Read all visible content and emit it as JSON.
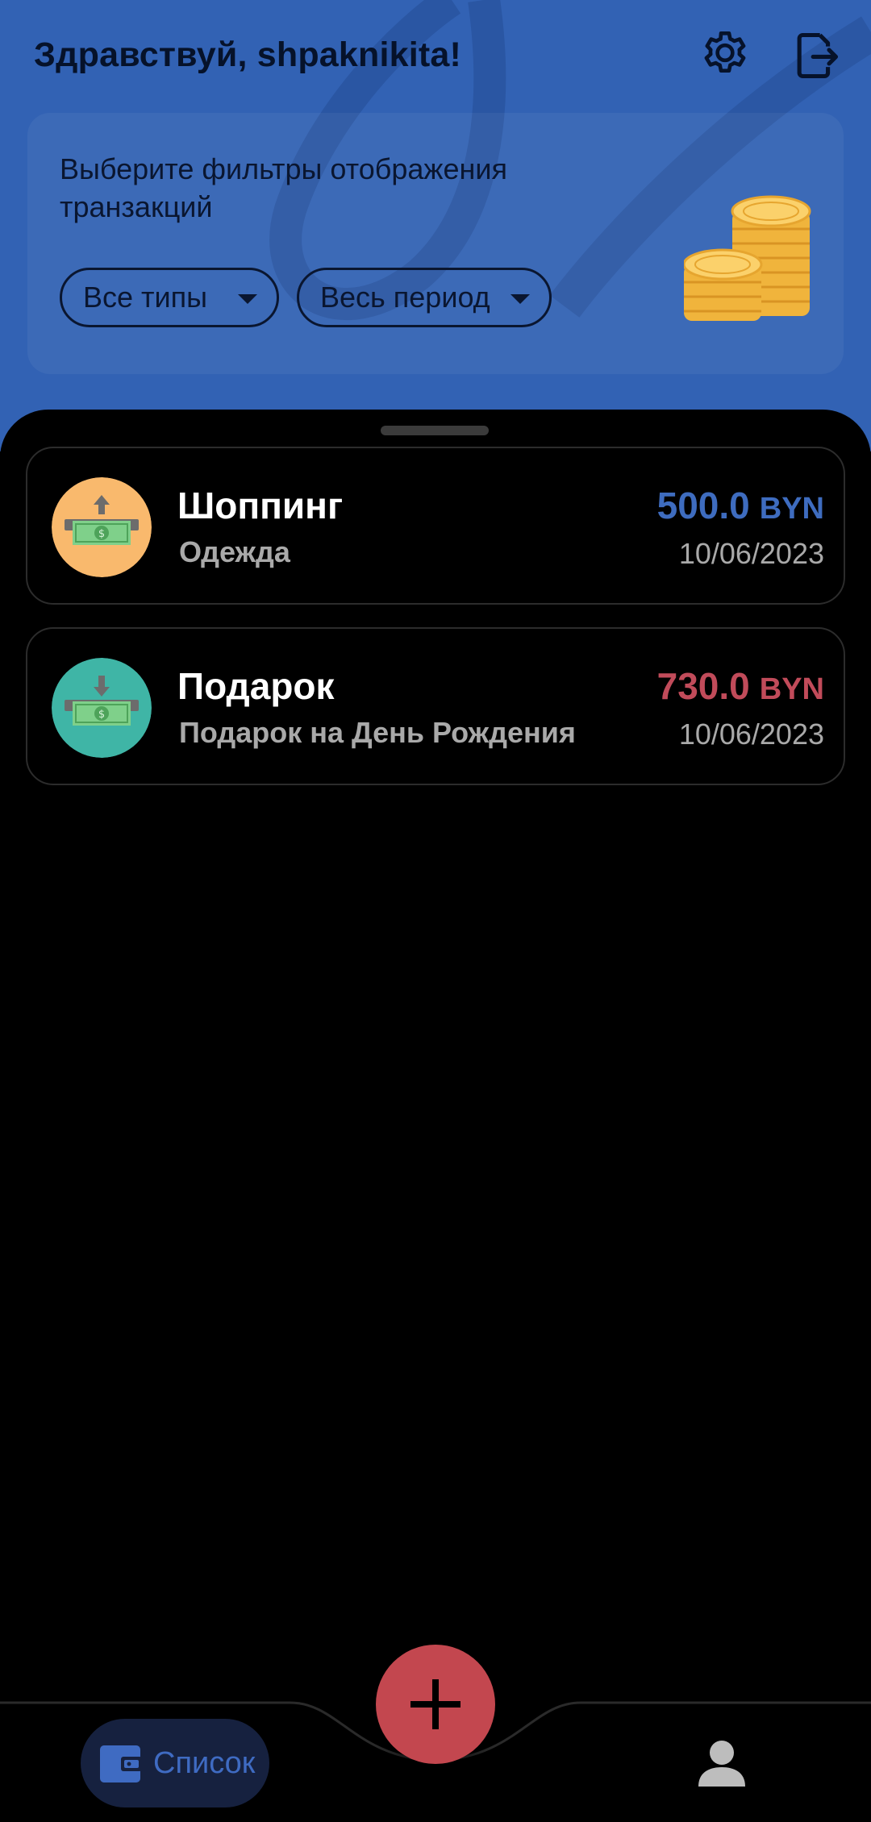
{
  "header": {
    "greeting": "Здравствуй, shpaknikita!",
    "settings_icon": "gear-icon",
    "logout_icon": "logout-icon"
  },
  "filters": {
    "hint": "Выберите фильтры отображения транзакций",
    "type_filter": "Все типы",
    "period_filter": "Весь период",
    "illustration": "coins-stack"
  },
  "transactions": [
    {
      "title": "Шоппинг",
      "subtitle": "Одежда",
      "amount": "500.0",
      "currency": "BYN",
      "date": "10/06/2023",
      "icon": "cash-withdraw-icon",
      "icon_bg": "#f9b96d",
      "amount_color": "#3e6cbf"
    },
    {
      "title": "Подарок",
      "subtitle": "Подарок на День Рождения",
      "amount": "730.0",
      "currency": "BYN",
      "date": "10/06/2023",
      "icon": "cash-deposit-icon",
      "icon_bg": "#3fb5a6",
      "amount_color": "#c14b5a"
    }
  ],
  "nav": {
    "list_label": "Список",
    "add_icon": "plus-icon",
    "profile_icon": "person-icon"
  },
  "colors": {
    "header_bg": "#3262b4",
    "fab": "#c3474f",
    "accent_blue": "#3f6bc2"
  }
}
